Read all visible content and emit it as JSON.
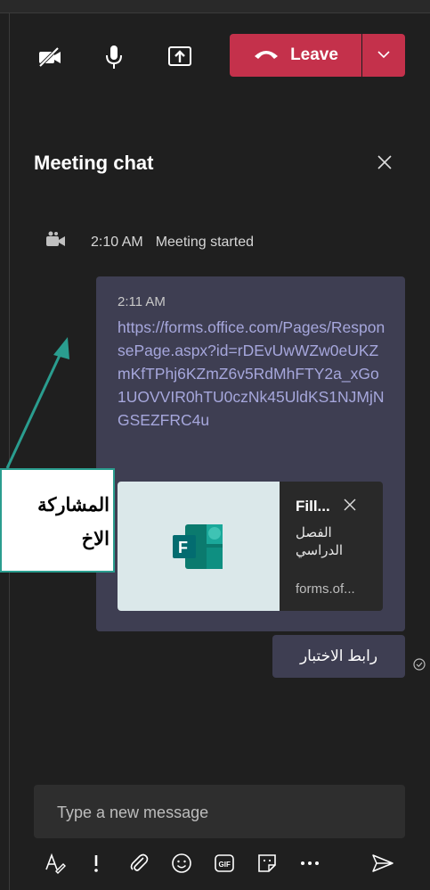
{
  "toolbar": {
    "icons": [
      "camera-off-icon",
      "microphone-icon",
      "share-screen-icon"
    ],
    "leave_label": "Leave",
    "leave_color": "#c4314b"
  },
  "chat": {
    "title": "Meeting chat",
    "system_message": {
      "time": "2:10 AM",
      "text": "Meeting started"
    },
    "message": {
      "time": "2:11 AM",
      "link": "https://forms.office.com/Pages/ResponsePage.aspx?id=rDEvUwWZw0eUKZmKfTPhj6KZmZ6v5RdMhFTY2a_xGo1UOVVIR0hTU0czNk45UldKS1NJMjNGSEZFRC4u",
      "link_color": "#a6a7dc",
      "card": {
        "title": "Fill...",
        "description": "الفصل الدراسي",
        "domain": "forms.of..."
      }
    },
    "reply": "رابط الاختبار"
  },
  "annotation": {
    "line1": "المشاركة",
    "line2": "الاخ"
  },
  "compose": {
    "placeholder": "Type a new message",
    "icons": [
      "format-icon",
      "important-icon",
      "attach-icon",
      "emoji-icon",
      "gif-icon",
      "sticker-icon",
      "more-icon",
      "send-icon"
    ]
  }
}
